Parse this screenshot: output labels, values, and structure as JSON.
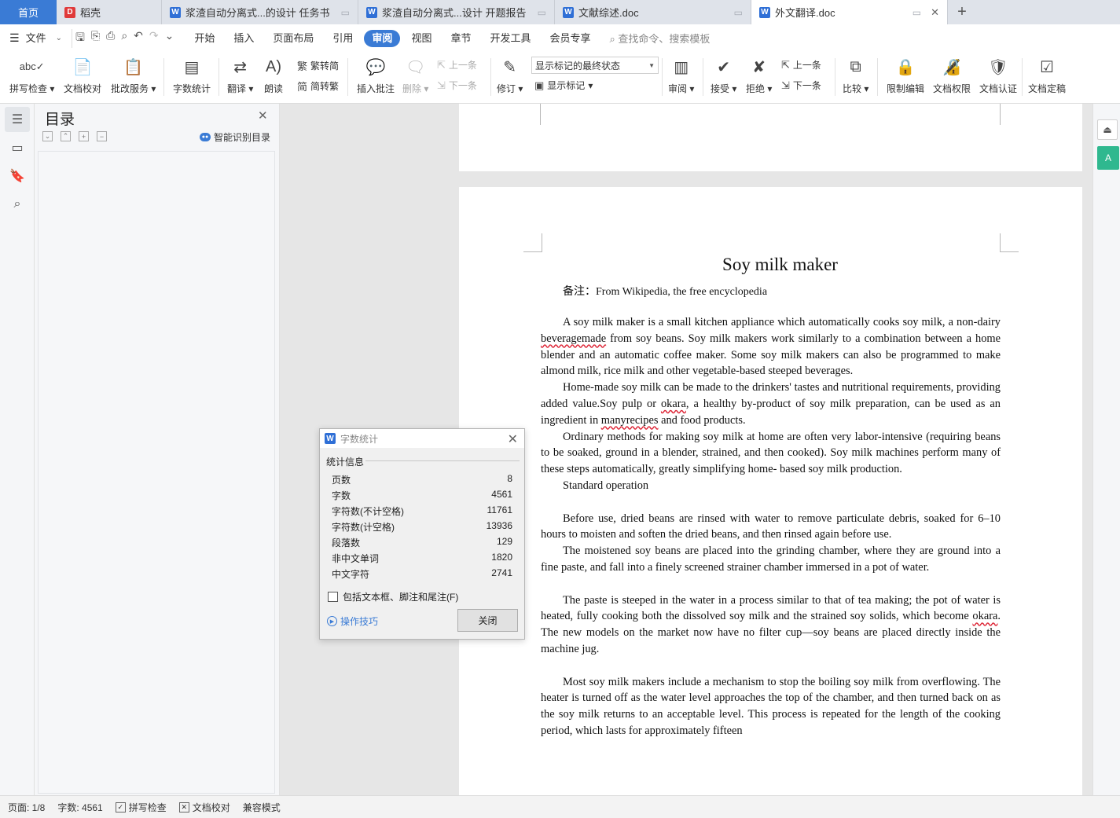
{
  "tabs": {
    "home": "首页",
    "items": [
      {
        "label": "稻壳",
        "icon": "daoke-icon"
      },
      {
        "label": "浆渣自动分离式...的设计 任务书",
        "icon": "word-icon"
      },
      {
        "label": "浆渣自动分离式...设计 开题报告",
        "icon": "word-icon"
      },
      {
        "label": "文献综述.doc",
        "icon": "word-icon"
      },
      {
        "label": "外文翻译.doc",
        "icon": "word-icon",
        "active": true
      }
    ],
    "add": "+"
  },
  "menu": {
    "file": "文件",
    "items": [
      "开始",
      "插入",
      "页面布局",
      "引用",
      "审阅",
      "视图",
      "章节",
      "开发工具",
      "会员专享"
    ],
    "active": "审阅",
    "search": "查找命令、搜索模板"
  },
  "ribbon": {
    "spellcheck": "拼写检查",
    "proofread": "文档校对",
    "correction": "批改服务",
    "wordcount": "字数统计",
    "translate": "翻译",
    "read": "朗读",
    "trad_to_simp": "繁转简",
    "simp_to_trad": "简转繁",
    "insert_comment": "插入批注",
    "delete": "删除",
    "prev_comment": "上一条",
    "next_comment": "下一条",
    "revise": "修订",
    "markup_state": "显示标记的最终状态",
    "show_markup": "显示标记",
    "review": "审阅",
    "accept": "接受",
    "reject": "拒绝",
    "prev_change": "上一条",
    "next_change": "下一条",
    "compare": "比较",
    "restrict": "限制编辑",
    "permission": "文档权限",
    "certify": "文档认证",
    "finalize": "文档定稿"
  },
  "toc": {
    "title": "目录",
    "smart": "智能识别目录"
  },
  "document": {
    "title": "Soy milk maker",
    "note_label": "备注：",
    "note_text": "From Wikipedia, the free encyclopedia",
    "p1a": "A soy milk maker is a small kitchen appliance which automatically cooks soy milk, a non-dairy ",
    "p1b": "beveragemade",
    "p1c": " from soy beans. Soy milk makers work similarly to a combination between a home blender and an automatic coffee maker. Some soy milk makers can also be programmed to make almond milk, rice milk and other vegetable-based steeped beverages.",
    "p2a": "Home-made soy milk can be made to the drinkers' tastes and nutritional requirements, providing added value.Soy pulp or ",
    "p2b": "okara",
    "p2c": ", a healthy by-product of soy milk preparation, can be used as an ingredient in ",
    "p2d": "manyrecipes",
    "p2e": " and food products.",
    "p3": "Ordinary methods for making soy milk at home are often very labor-intensive (requiring beans to be soaked, ground in a blender, strained, and then cooked). Soy milk machines perform many of these steps automatically, greatly simplifying home- based soy milk production.",
    "p4": "Standard operation",
    "p5": "Before use, dried beans are rinsed with water to remove particulate debris, soaked for 6–10 hours to moisten and soften the dried beans, and then rinsed again before use.",
    "p6": "The moistened soy beans are placed into the grinding chamber, where they are ground into a fine paste, and fall into a finely screened strainer chamber immersed in a pot of water.",
    "p7a": "The paste is steeped in the water in a process similar to that of tea making; the pot of water is heated, fully cooking both the dissolved soy milk and the strained soy solids, which become ",
    "p7b": "okara",
    "p7c": ". The new models on the market now have no filter cup—soy beans are placed directly inside the machine jug.",
    "p8": "Most soy milk makers include a mechanism to stop the boiling soy milk from overflowing. The heater is turned off as the water level approaches the top of the chamber, and then turned back on as the soy milk returns to an acceptable level. This process is repeated for the length of the cooking period, which lasts for approximately fifteen"
  },
  "dialog": {
    "title": "字数统计",
    "group": "统计信息",
    "stats": [
      {
        "label": "页数",
        "value": "8"
      },
      {
        "label": "字数",
        "value": "4561"
      },
      {
        "label": "字符数(不计空格)",
        "value": "11761"
      },
      {
        "label": "字符数(计空格)",
        "value": "13936"
      },
      {
        "label": "段落数",
        "value": "129"
      },
      {
        "label": "非中文单词",
        "value": "1820"
      },
      {
        "label": "中文字符",
        "value": "2741"
      }
    ],
    "include_label": "包括文本框、脚注和尾注(F)",
    "tips": "操作技巧",
    "close": "关闭"
  },
  "status": {
    "page": "页面: 1/8",
    "words": "字数: 4561",
    "spell": "拼写检查",
    "proof": "文档校对",
    "compat": "兼容模式"
  },
  "colors": {
    "accent": "#3a7bd5",
    "misspelling": "#dd2233",
    "side_tool": "#2fb88f"
  }
}
